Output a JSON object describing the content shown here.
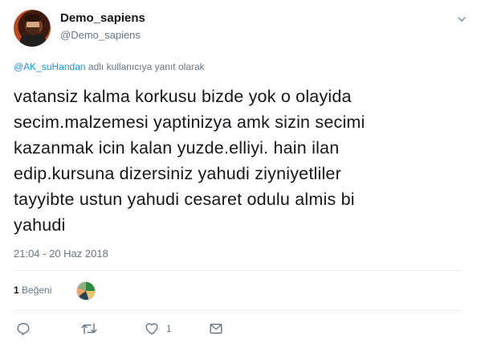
{
  "user": {
    "display_name": "Demo_sapiens",
    "handle": "@Demo_sapiens"
  },
  "reply": {
    "mention": "@AK_suHandan",
    "suffix": " adlı kullanıcıya yanıt olarak"
  },
  "tweet": {
    "text": "vatansiz kalma korkusu bizde yok  o olayida\nsecim.malzemesi yaptinizya amk sizin secimi\nkazanmak icin kalan yuzde.elliyi. hain ilan\nedip.kursuna dizersiniz yahudi ziyniyetliler\ntayyibte ustun yahudi cesaret odulu almis bi\nyahudi",
    "timestamp": "21:04 - 20 Haz 2018"
  },
  "stats": {
    "like_count": "1",
    "like_label": "Beğeni"
  },
  "actions": {
    "reply_icon": "reply-icon",
    "retweet_icon": "retweet-icon",
    "like_icon": "heart-icon",
    "like_count": "1",
    "dm_icon": "message-icon"
  },
  "colors": {
    "link": "#1b95e0",
    "secondary_text": "#657786",
    "divider": "#e6ecf0"
  }
}
